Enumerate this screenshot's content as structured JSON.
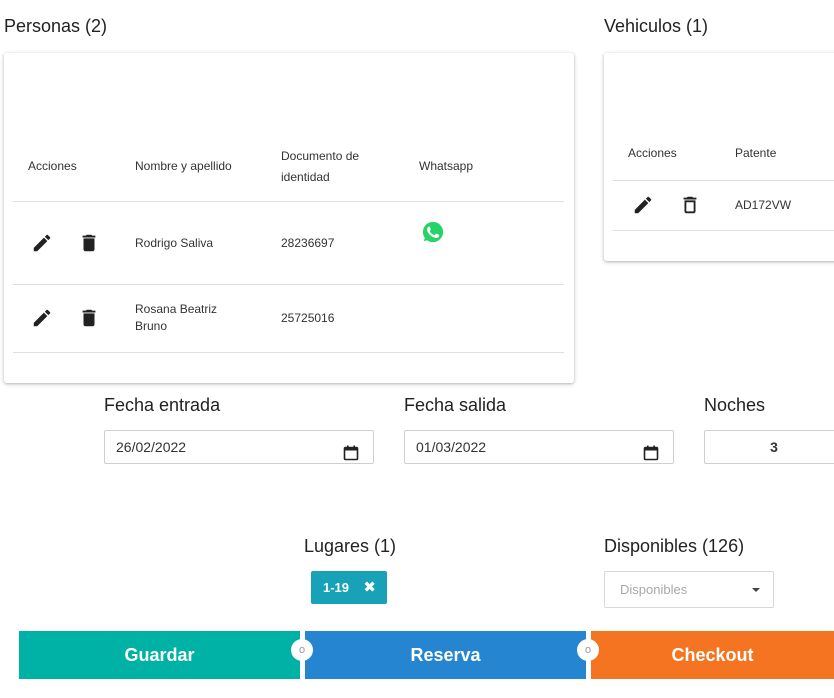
{
  "personas": {
    "title": "Personas (2)",
    "headers": {
      "acciones": "Acciones",
      "nombre": "Nombre y apellido",
      "documento_line1": "Documento de",
      "documento_line2": "identidad",
      "whatsapp": "Whatsapp"
    },
    "rows": [
      {
        "nombre_line1": "Rodrigo Saliva",
        "nombre_line2": "",
        "documento": "28236697",
        "whatsapp": true
      },
      {
        "nombre_line1": "Rosana Beatriz",
        "nombre_line2": "Bruno",
        "documento": "25725016",
        "whatsapp": false
      }
    ]
  },
  "vehiculos": {
    "title": "Vehiculos (1)",
    "headers": {
      "acciones": "Acciones",
      "patente": "Patente"
    },
    "rows": [
      {
        "patente": "AD172VW"
      }
    ]
  },
  "fechas": {
    "entrada_label": "Fecha entrada",
    "entrada_value": "26/02/2022",
    "salida_label": "Fecha salida",
    "salida_value": "01/03/2022",
    "noches_label": "Noches",
    "noches_value": "3"
  },
  "lugares": {
    "title": "Lugares (1)",
    "chip": "1-19",
    "chip_remove": "✖"
  },
  "disponibles": {
    "title": "Disponibles (126)",
    "placeholder": "Disponibles"
  },
  "buttons": {
    "guardar": "Guardar",
    "reserva": "Reserva",
    "checkout": "Checkout",
    "connector": "o"
  },
  "colors": {
    "guardar": "#00b1a5",
    "reserva": "#2585d0",
    "checkout": "#f47421",
    "chip": "#17a2b8",
    "whatsapp": "#25d366"
  }
}
